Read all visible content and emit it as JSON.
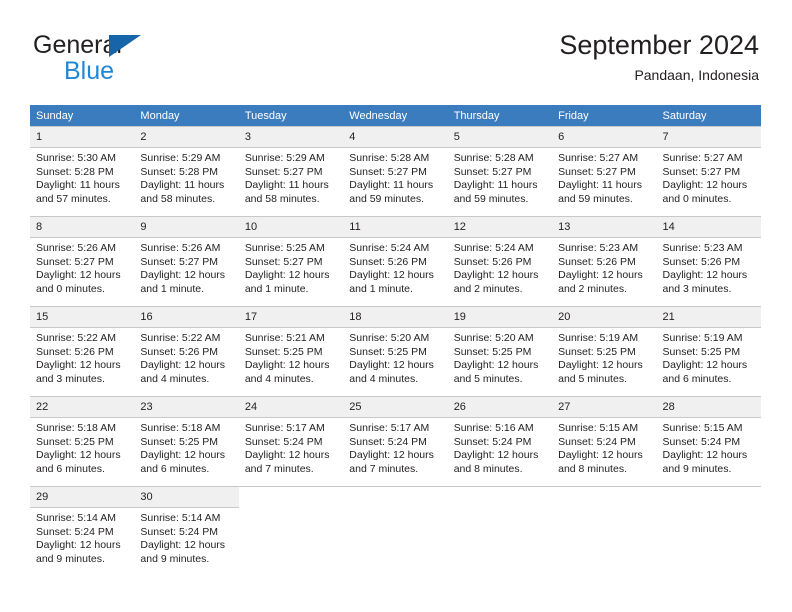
{
  "brand": {
    "name_part1": "General",
    "name_part2": "Blue",
    "logo_icon": "blue-triangle-logo"
  },
  "header": {
    "title": "September 2024",
    "subtitle": "Pandaan, Indonesia"
  },
  "calendar": {
    "weekday_headers": [
      "Sunday",
      "Monday",
      "Tuesday",
      "Wednesday",
      "Thursday",
      "Friday",
      "Saturday"
    ],
    "accent_color": "#3b7cbf",
    "daynum_bg_color": "#f0f0f0",
    "grid_line_color": "#c8c8c8",
    "weeks": [
      [
        {
          "day": "",
          "sunrise": "",
          "sunset": "",
          "daylight_line1": "",
          "daylight_line2": ""
        },
        {
          "day": "",
          "sunrise": "",
          "sunset": "",
          "daylight_line1": "",
          "daylight_line2": ""
        },
        {
          "day": "",
          "sunrise": "",
          "sunset": "",
          "daylight_line1": "",
          "daylight_line2": ""
        },
        {
          "day": "",
          "sunrise": "",
          "sunset": "",
          "daylight_line1": "",
          "daylight_line2": ""
        },
        {
          "day": "",
          "sunrise": "",
          "sunset": "",
          "daylight_line1": "",
          "daylight_line2": ""
        },
        {
          "day": "",
          "sunrise": "",
          "sunset": "",
          "daylight_line1": "",
          "daylight_line2": ""
        },
        {
          "day": "",
          "sunrise": "",
          "sunset": "",
          "daylight_line1": "",
          "daylight_line2": ""
        }
      ],
      [
        {
          "day": "1",
          "sunrise": "Sunrise: 5:30 AM",
          "sunset": "Sunset: 5:28 PM",
          "daylight_line1": "Daylight: 11 hours",
          "daylight_line2": "and 57 minutes."
        },
        {
          "day": "2",
          "sunrise": "Sunrise: 5:29 AM",
          "sunset": "Sunset: 5:28 PM",
          "daylight_line1": "Daylight: 11 hours",
          "daylight_line2": "and 58 minutes."
        },
        {
          "day": "3",
          "sunrise": "Sunrise: 5:29 AM",
          "sunset": "Sunset: 5:27 PM",
          "daylight_line1": "Daylight: 11 hours",
          "daylight_line2": "and 58 minutes."
        },
        {
          "day": "4",
          "sunrise": "Sunrise: 5:28 AM",
          "sunset": "Sunset: 5:27 PM",
          "daylight_line1": "Daylight: 11 hours",
          "daylight_line2": "and 59 minutes."
        },
        {
          "day": "5",
          "sunrise": "Sunrise: 5:28 AM",
          "sunset": "Sunset: 5:27 PM",
          "daylight_line1": "Daylight: 11 hours",
          "daylight_line2": "and 59 minutes."
        },
        {
          "day": "6",
          "sunrise": "Sunrise: 5:27 AM",
          "sunset": "Sunset: 5:27 PM",
          "daylight_line1": "Daylight: 11 hours",
          "daylight_line2": "and 59 minutes."
        },
        {
          "day": "7",
          "sunrise": "Sunrise: 5:27 AM",
          "sunset": "Sunset: 5:27 PM",
          "daylight_line1": "Daylight: 12 hours",
          "daylight_line2": "and 0 minutes."
        }
      ],
      [
        {
          "day": "8",
          "sunrise": "Sunrise: 5:26 AM",
          "sunset": "Sunset: 5:27 PM",
          "daylight_line1": "Daylight: 12 hours",
          "daylight_line2": "and 0 minutes."
        },
        {
          "day": "9",
          "sunrise": "Sunrise: 5:26 AM",
          "sunset": "Sunset: 5:27 PM",
          "daylight_line1": "Daylight: 12 hours",
          "daylight_line2": "and 1 minute."
        },
        {
          "day": "10",
          "sunrise": "Sunrise: 5:25 AM",
          "sunset": "Sunset: 5:27 PM",
          "daylight_line1": "Daylight: 12 hours",
          "daylight_line2": "and 1 minute."
        },
        {
          "day": "11",
          "sunrise": "Sunrise: 5:24 AM",
          "sunset": "Sunset: 5:26 PM",
          "daylight_line1": "Daylight: 12 hours",
          "daylight_line2": "and 1 minute."
        },
        {
          "day": "12",
          "sunrise": "Sunrise: 5:24 AM",
          "sunset": "Sunset: 5:26 PM",
          "daylight_line1": "Daylight: 12 hours",
          "daylight_line2": "and 2 minutes."
        },
        {
          "day": "13",
          "sunrise": "Sunrise: 5:23 AM",
          "sunset": "Sunset: 5:26 PM",
          "daylight_line1": "Daylight: 12 hours",
          "daylight_line2": "and 2 minutes."
        },
        {
          "day": "14",
          "sunrise": "Sunrise: 5:23 AM",
          "sunset": "Sunset: 5:26 PM",
          "daylight_line1": "Daylight: 12 hours",
          "daylight_line2": "and 3 minutes."
        }
      ],
      [
        {
          "day": "15",
          "sunrise": "Sunrise: 5:22 AM",
          "sunset": "Sunset: 5:26 PM",
          "daylight_line1": "Daylight: 12 hours",
          "daylight_line2": "and 3 minutes."
        },
        {
          "day": "16",
          "sunrise": "Sunrise: 5:22 AM",
          "sunset": "Sunset: 5:26 PM",
          "daylight_line1": "Daylight: 12 hours",
          "daylight_line2": "and 4 minutes."
        },
        {
          "day": "17",
          "sunrise": "Sunrise: 5:21 AM",
          "sunset": "Sunset: 5:25 PM",
          "daylight_line1": "Daylight: 12 hours",
          "daylight_line2": "and 4 minutes."
        },
        {
          "day": "18",
          "sunrise": "Sunrise: 5:20 AM",
          "sunset": "Sunset: 5:25 PM",
          "daylight_line1": "Daylight: 12 hours",
          "daylight_line2": "and 4 minutes."
        },
        {
          "day": "19",
          "sunrise": "Sunrise: 5:20 AM",
          "sunset": "Sunset: 5:25 PM",
          "daylight_line1": "Daylight: 12 hours",
          "daylight_line2": "and 5 minutes."
        },
        {
          "day": "20",
          "sunrise": "Sunrise: 5:19 AM",
          "sunset": "Sunset: 5:25 PM",
          "daylight_line1": "Daylight: 12 hours",
          "daylight_line2": "and 5 minutes."
        },
        {
          "day": "21",
          "sunrise": "Sunrise: 5:19 AM",
          "sunset": "Sunset: 5:25 PM",
          "daylight_line1": "Daylight: 12 hours",
          "daylight_line2": "and 6 minutes."
        }
      ],
      [
        {
          "day": "22",
          "sunrise": "Sunrise: 5:18 AM",
          "sunset": "Sunset: 5:25 PM",
          "daylight_line1": "Daylight: 12 hours",
          "daylight_line2": "and 6 minutes."
        },
        {
          "day": "23",
          "sunrise": "Sunrise: 5:18 AM",
          "sunset": "Sunset: 5:25 PM",
          "daylight_line1": "Daylight: 12 hours",
          "daylight_line2": "and 6 minutes."
        },
        {
          "day": "24",
          "sunrise": "Sunrise: 5:17 AM",
          "sunset": "Sunset: 5:24 PM",
          "daylight_line1": "Daylight: 12 hours",
          "daylight_line2": "and 7 minutes."
        },
        {
          "day": "25",
          "sunrise": "Sunrise: 5:17 AM",
          "sunset": "Sunset: 5:24 PM",
          "daylight_line1": "Daylight: 12 hours",
          "daylight_line2": "and 7 minutes."
        },
        {
          "day": "26",
          "sunrise": "Sunrise: 5:16 AM",
          "sunset": "Sunset: 5:24 PM",
          "daylight_line1": "Daylight: 12 hours",
          "daylight_line2": "and 8 minutes."
        },
        {
          "day": "27",
          "sunrise": "Sunrise: 5:15 AM",
          "sunset": "Sunset: 5:24 PM",
          "daylight_line1": "Daylight: 12 hours",
          "daylight_line2": "and 8 minutes."
        },
        {
          "day": "28",
          "sunrise": "Sunrise: 5:15 AM",
          "sunset": "Sunset: 5:24 PM",
          "daylight_line1": "Daylight: 12 hours",
          "daylight_line2": "and 9 minutes."
        }
      ],
      [
        {
          "day": "29",
          "sunrise": "Sunrise: 5:14 AM",
          "sunset": "Sunset: 5:24 PM",
          "daylight_line1": "Daylight: 12 hours",
          "daylight_line2": "and 9 minutes."
        },
        {
          "day": "30",
          "sunrise": "Sunrise: 5:14 AM",
          "sunset": "Sunset: 5:24 PM",
          "daylight_line1": "Daylight: 12 hours",
          "daylight_line2": "and 9 minutes."
        },
        {
          "day": "",
          "sunrise": "",
          "sunset": "",
          "daylight_line1": "",
          "daylight_line2": ""
        },
        {
          "day": "",
          "sunrise": "",
          "sunset": "",
          "daylight_line1": "",
          "daylight_line2": ""
        },
        {
          "day": "",
          "sunrise": "",
          "sunset": "",
          "daylight_line1": "",
          "daylight_line2": ""
        },
        {
          "day": "",
          "sunrise": "",
          "sunset": "",
          "daylight_line1": "",
          "daylight_line2": ""
        },
        {
          "day": "",
          "sunrise": "",
          "sunset": "",
          "daylight_line1": "",
          "daylight_line2": ""
        }
      ]
    ]
  }
}
